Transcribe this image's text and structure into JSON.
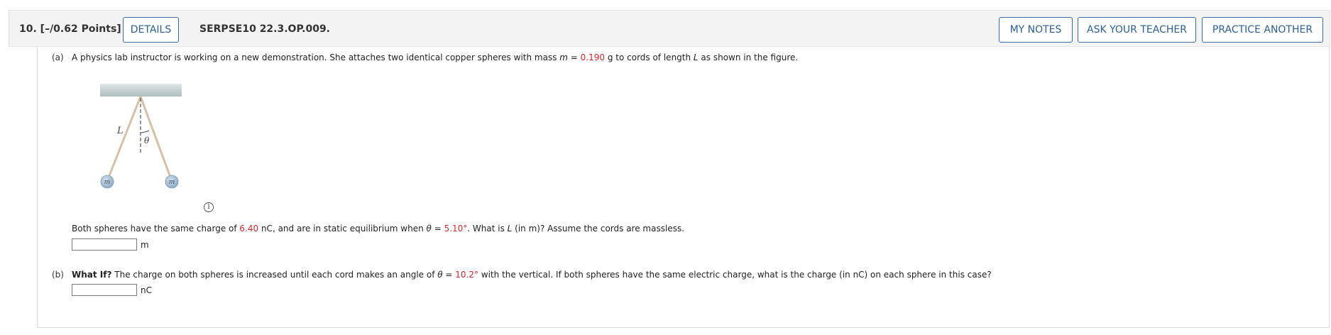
{
  "header": {
    "question_points": "10.  [–/0.62 Points]",
    "details_label": "DETAILS",
    "question_id": "SERPSE10 22.3.OP.009.",
    "my_notes_label": "MY NOTES",
    "ask_teacher_label": "ASK YOUR TEACHER",
    "practice_label": "PRACTICE ANOTHER"
  },
  "part_a": {
    "label": "(a)",
    "intro_1": "A physics lab instructor is working on a new demonstration. She attaches two identical copper spheres with mass ",
    "mass_symbol": "m",
    "equals": " = ",
    "mass_value": "0.190",
    "intro_2": " g to cords of length ",
    "length_symbol": "L",
    "intro_3": " as shown in the figure.",
    "figure": {
      "length_label": "L",
      "angle_label": "θ",
      "sphere_left_label": "m",
      "sphere_right_label": "m",
      "info_icon": "i"
    },
    "q_1": "Both spheres have the same charge of ",
    "charge_value": "6.40",
    "q_2": " nC, and are in static equilibrium when ",
    "theta_symbol": "θ",
    "q_equals": " = ",
    "angle_value": "5.10°",
    "q_3": ". What is ",
    "q_L": "L",
    "q_4": " (in m)? Assume the cords are massless.",
    "unit": "m"
  },
  "part_b": {
    "label": "(b)",
    "bold": "What If?",
    "t_1": " The charge on both spheres is increased until each cord makes an angle of ",
    "theta_symbol": "θ",
    "equals": " = ",
    "angle_value": "10.2°",
    "t_2": " with the vertical. If both spheres have the same electric charge, what is the charge (in nC) on each sphere in this case?",
    "unit": "nC"
  }
}
